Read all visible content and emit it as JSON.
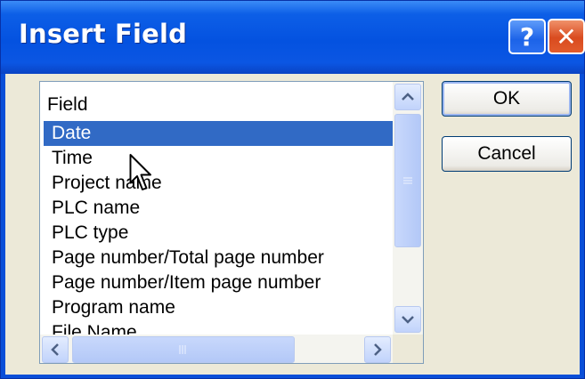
{
  "window": {
    "title": "Insert Field",
    "help_label": "?",
    "close_label": "✕"
  },
  "list": {
    "header": "Field",
    "items": [
      "Date",
      "Time",
      "Project name",
      "PLC name",
      "PLC type",
      "Page number/Total page number",
      "Page number/Item page number",
      "Program name",
      "File Name"
    ],
    "selected": "Date"
  },
  "buttons": {
    "ok": "OK",
    "cancel": "Cancel"
  },
  "icons": {
    "scroll_up": "triangle-up-icon",
    "scroll_down": "triangle-down-icon",
    "scroll_left": "triangle-left-icon",
    "scroll_right": "triangle-right-icon",
    "cursor": "mouse-pointer-icon"
  },
  "colors": {
    "title_bar": "#0452e0",
    "selection": "#316ac5",
    "dialog_bg": "#ece9d8"
  }
}
